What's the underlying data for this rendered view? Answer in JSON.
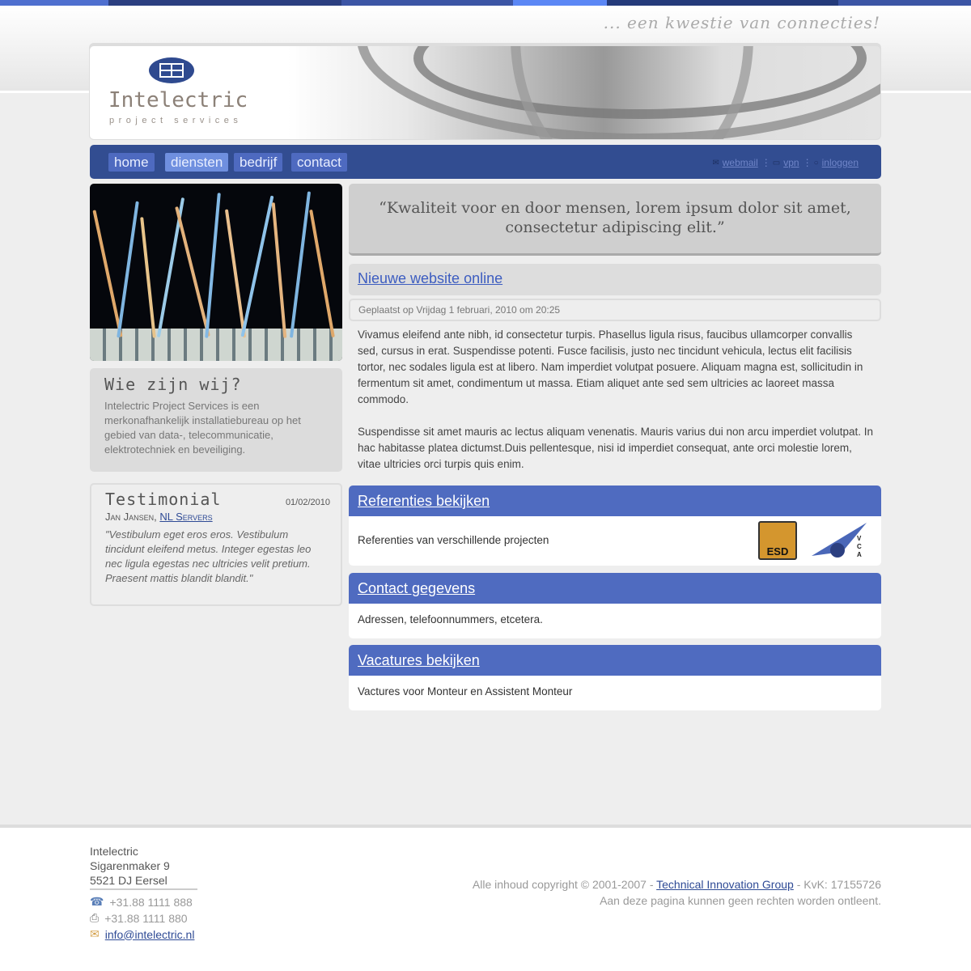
{
  "colors": {
    "accent": "#324d91",
    "panel_header": "#4f6bc0",
    "link": "#3d5dc0"
  },
  "header": {
    "tagline": "... een kwestie van connecties!",
    "logo_name": "Intelectric",
    "logo_sub": "project services"
  },
  "nav": {
    "items": [
      {
        "label": "home",
        "active": false
      },
      {
        "label": "diensten",
        "active": true
      },
      {
        "label": "bedrijf",
        "active": false
      },
      {
        "label": "contact",
        "active": false
      }
    ],
    "utility": [
      {
        "icon": "envelope-icon",
        "label": "webmail"
      },
      {
        "icon": "folder-icon",
        "label": "vpn"
      },
      {
        "icon": "lock-icon",
        "label": "inloggen"
      }
    ]
  },
  "sidebar": {
    "who": {
      "title": "Wie zijn wij?",
      "text": "Intelectric Project Services is een merkonafhankelijk installatiebureau op het gebied van data-, telecommunicatie, elektrotechniek en beveiliging."
    },
    "testimonial": {
      "title": "Testimonial",
      "date": "01/02/2010",
      "author": "Jan Jansen",
      "company": "NL Servers",
      "quote": "\"Vestibulum eget eros eros. Vestibulum tincidunt eleifend metus. Integer egestas leo nec ligula egestas nec ultricies velit pretium. Praesent mattis blandit blandit.\""
    }
  },
  "main": {
    "quote": "“Kwaliteit voor en door mensen, lorem ipsum dolor sit amet, consectetur adipiscing elit.”",
    "post": {
      "title": "Nieuwe website online",
      "meta": "Geplaatst op Vrijdag 1 februari, 2010 om 20:25",
      "paragraphs": [
        "Vivamus eleifend ante nibh, id consectetur turpis. Phasellus ligula risus, faucibus ullamcorper convallis sed, cursus in erat. Suspendisse potenti. Fusce facilisis, justo nec tincidunt vehicula, lectus elit facilisis tortor, nec sodales ligula est at libero. Nam imperdiet volutpat posuere. Aliquam magna est, sollicitudin in fermentum sit amet, condimentum ut massa. Etiam aliquet ante sed sem ultricies ac laoreet massa commodo.",
        "Suspendisse sit amet mauris ac lectus aliquam venenatis. Mauris varius dui non arcu imperdiet volutpat. In hac habitasse platea dictumst.Duis pellentesque, nisi id imperdiet consequat, ante orci molestie lorem, vitae ultricies orci turpis quis enim."
      ]
    },
    "panels": [
      {
        "title": "Referenties bekijken",
        "text": "Referenties van verschillende projecten",
        "logos": [
          "ESD",
          "VCA"
        ]
      },
      {
        "title": "Contact gegevens",
        "text": "Adressen, telefoonnummers, etcetera."
      },
      {
        "title": "Vacatures bekijken",
        "text": "Vactures voor Monteur en Assistent Monteur"
      }
    ]
  },
  "footer": {
    "address": [
      "Intelectric",
      "Sigarenmaker 9",
      "5521 DJ Eersel"
    ],
    "phone": "+31.88 1111 888",
    "fax": "+31.88 1111 880",
    "email": "info@intelectric.nl",
    "copyright_prefix": "Alle inhoud copyright © 2001-2007 - ",
    "copyright_link": "Technical Innovation Group",
    "copyright_suffix": " - KvK: 17155726",
    "disclaimer": "Aan deze pagina kunnen geen rechten worden ontleent."
  }
}
